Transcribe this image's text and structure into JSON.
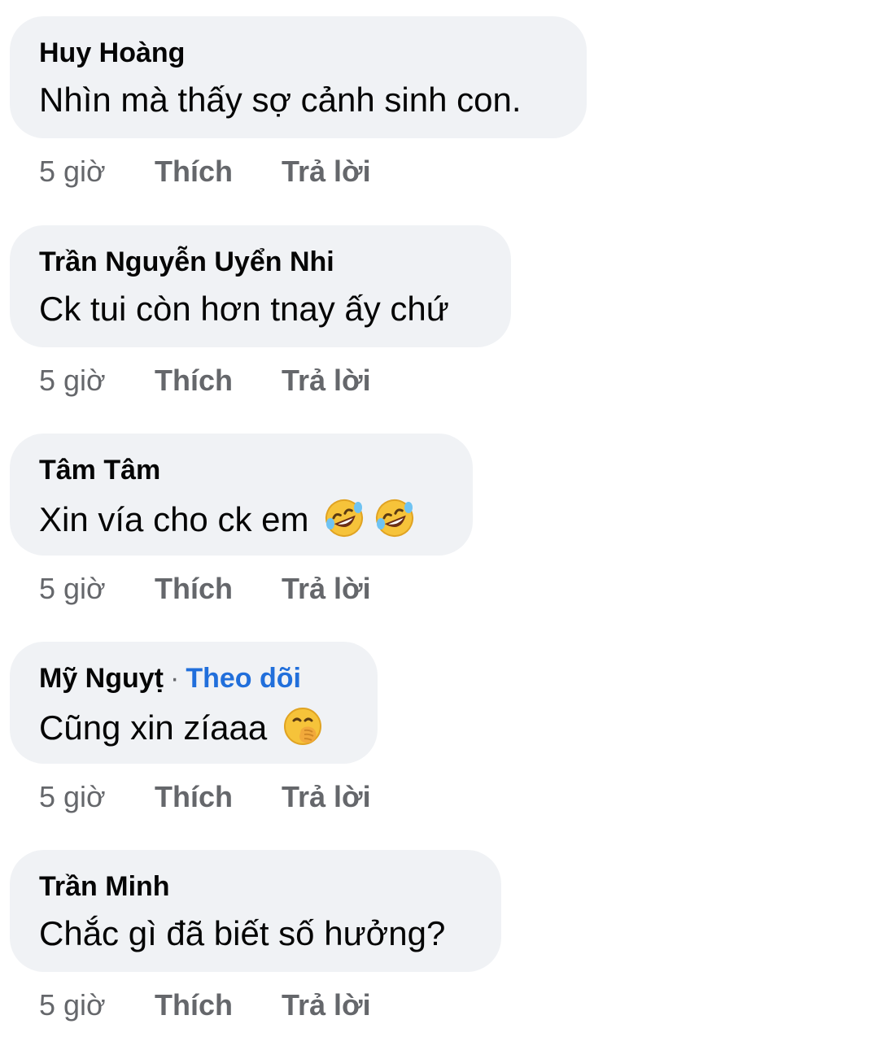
{
  "comments": [
    {
      "author": "Huy Hoàng",
      "text": "Nhìn mà thấy sợ cảnh sinh con.",
      "time": "5 giờ",
      "like_label": "Thích",
      "reply_label": "Trả lời"
    },
    {
      "author": "Trần Nguyễn Uyển Nhi",
      "text": "Ck tui còn hơn tnay ấy chứ",
      "time": "5 giờ",
      "like_label": "Thích",
      "reply_label": "Trả lời"
    },
    {
      "author": "Tâm Tâm",
      "text": "Xin vía cho ck em",
      "emojis": [
        "rolling-on-floor-laughing-emoji",
        "rolling-on-floor-laughing-emoji"
      ],
      "time": "5 giờ",
      "like_label": "Thích",
      "reply_label": "Trả lời"
    },
    {
      "author": "Mỹ Nguyṭ",
      "separator": "·",
      "follow_label": "Theo dõi",
      "text": "Cũng xin zíaaa",
      "emojis": [
        "face-with-hand-over-mouth-emoji"
      ],
      "time": "5 giờ",
      "like_label": "Thích",
      "reply_label": "Trả lời"
    },
    {
      "author": "Trần Minh",
      "text": "Chắc gì đã biết số hưởng?",
      "time": "5 giờ",
      "like_label": "Thích",
      "reply_label": "Trả lời"
    }
  ],
  "colors": {
    "bubble_background": "#f0f2f5",
    "primary_text": "#050505",
    "secondary_text": "#65676b",
    "link": "#216fdb"
  }
}
